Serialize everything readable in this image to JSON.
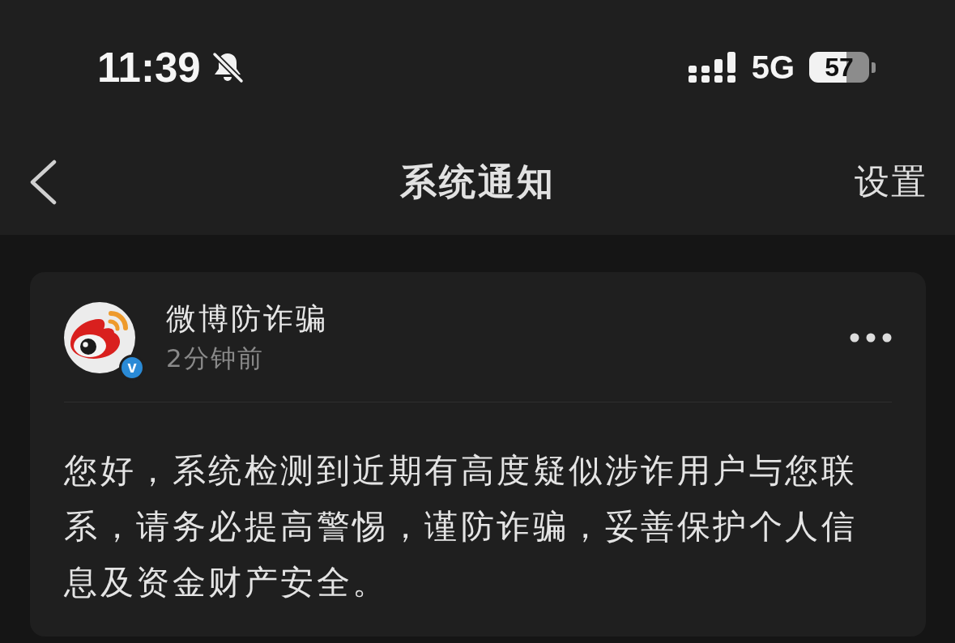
{
  "status_bar": {
    "time": "11:39",
    "silent": true,
    "network": "5G",
    "battery": "57"
  },
  "nav_bar": {
    "title": "系统通知",
    "action": "设置"
  },
  "notification": {
    "sender": "微博防诈骗",
    "verified": true,
    "badge": "v",
    "time": "2分钟前",
    "message": "您好，系统检测到近期有高度疑似涉诈用户与您联系，请务必提高警惕，谨防诈骗，妥善保护个人信息及资金财产安全。"
  }
}
